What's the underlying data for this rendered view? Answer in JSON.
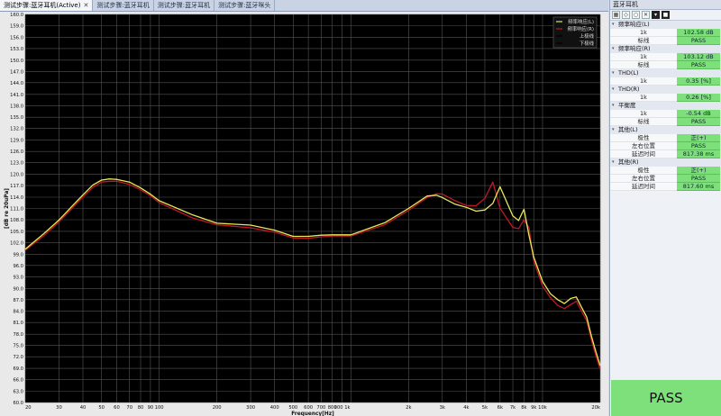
{
  "tabs": [
    {
      "label": "测试步骤:蓝牙耳机(Active)",
      "active": true
    },
    {
      "label": "测试步骤:蓝牙耳机",
      "active": false
    },
    {
      "label": "测试步骤:蓝牙耳机",
      "active": false
    },
    {
      "label": "测试步骤:蓝牙咪头",
      "active": false
    }
  ],
  "panel": {
    "title": "蓝牙耳机",
    "groups": [
      {
        "title": "频率响应(L)",
        "rows": [
          [
            "1k",
            "102.58 dB"
          ],
          [
            "标线",
            "PASS"
          ]
        ]
      },
      {
        "title": "频率响应(R)",
        "rows": [
          [
            "1k",
            "103.12 dB"
          ],
          [
            "标线",
            "PASS"
          ]
        ]
      },
      {
        "title": "THD(L)",
        "rows": [
          [
            "1k",
            "0.35 [%]"
          ]
        ]
      },
      {
        "title": "THD(R)",
        "rows": [
          [
            "1k",
            "0.26 [%]"
          ]
        ]
      },
      {
        "title": "平衡度",
        "rows": [
          [
            "1k",
            "-0.54 dB"
          ],
          [
            "标线",
            "PASS"
          ]
        ]
      },
      {
        "title": "其他(L)",
        "rows": [
          [
            "极性",
            "正(+)"
          ],
          [
            "左右位置",
            "PASS"
          ],
          [
            "延迟时间",
            "817.38 ms"
          ]
        ]
      },
      {
        "title": "其他(R)",
        "rows": [
          [
            "极性",
            "正(+)"
          ],
          [
            "左右位置",
            "PASS"
          ],
          [
            "延迟时间",
            "817.60 ms"
          ]
        ]
      }
    ],
    "result": "PASS",
    "colors": {
      "pass": "#7ee07b"
    }
  },
  "chart_data": {
    "type": "line",
    "xlabel": "Frequency[Hz]",
    "ylabel": "[dB re 20uPa]",
    "x_scale": "log",
    "xlim": [
      20,
      20000
    ],
    "ylim": [
      60,
      160
    ],
    "yticks": [
      60.0,
      62.9,
      65.9,
      68.8,
      71.8,
      74.7,
      77.6,
      80.6,
      83.5,
      86.5,
      89.4,
      92.4,
      95.3,
      98.2,
      101.2,
      104.1,
      107.1,
      110.0,
      112.9,
      115.9,
      118.8,
      121.8,
      124.7,
      127.6,
      130.6,
      133.5,
      136.5,
      139.4,
      142.4,
      145.3,
      148.2,
      151.2,
      154.1,
      157.1,
      160.0
    ],
    "ytick_labels": [
      "60.0",
      "63.0",
      "66.0",
      "69.0",
      "72.0",
      "75.0",
      "78.0",
      "81.0",
      "84.0",
      "87.0",
      "90.0",
      "93.0",
      "96.0",
      "99.0",
      "102.0",
      "105.0",
      "108.0",
      "111.0",
      "114.0",
      "117.0",
      "120.0",
      "123.0",
      "126.0",
      "129.0",
      "132.0",
      "135.0",
      "138.0",
      "141.0",
      "144.0",
      "147.0",
      "150.0",
      "153.0",
      "156.0",
      "159.0",
      "160.0"
    ],
    "xticks": [
      20,
      30,
      40,
      50,
      60,
      70,
      80,
      90,
      100,
      200,
      300,
      400,
      500,
      600,
      700,
      800,
      900,
      1000,
      2000,
      3000,
      4000,
      5000,
      6000,
      7000,
      8000,
      9000,
      10000,
      20000
    ],
    "xtick_labels": [
      "20",
      "30",
      "40",
      "50",
      "60",
      "70",
      "80",
      "90",
      "100",
      "200",
      "300",
      "400",
      "500",
      "600",
      "700",
      "800",
      "900 1k",
      "",
      "2k",
      "3k",
      "4k",
      "5k",
      "6k",
      "7k",
      "8k",
      "9k",
      "10k",
      "20k"
    ],
    "grid": true,
    "legend_position": "top-right",
    "legend": [
      "频率响应(L)",
      "频率响应(R)",
      "上极线",
      "下极线"
    ],
    "series": [
      {
        "name": "频率响应(L)",
        "color": "#e8e85a",
        "x": [
          20,
          25,
          30,
          35,
          40,
          45,
          50,
          55,
          60,
          70,
          80,
          90,
          100,
          150,
          200,
          300,
          400,
          500,
          600,
          700,
          800,
          1000,
          1500,
          2000,
          2500,
          2800,
          3000,
          3500,
          4000,
          4500,
          5000,
          5500,
          6000,
          7000,
          7500,
          8000,
          8500,
          9000,
          10000,
          11000,
          12000,
          13000,
          14000,
          15000,
          16000,
          17000,
          18000,
          19000,
          20000
        ],
        "y": [
          99.5,
          103.5,
          107.0,
          110.5,
          113.5,
          116.0,
          117.3,
          117.6,
          117.5,
          116.8,
          115.3,
          113.7,
          112.0,
          108.3,
          106.2,
          105.7,
          104.4,
          102.8,
          102.8,
          103.1,
          103.2,
          103.2,
          106.3,
          110.0,
          113.2,
          113.4,
          112.8,
          111.1,
          110.3,
          109.3,
          109.6,
          111.3,
          115.6,
          108.1,
          106.9,
          109.8,
          103.0,
          97.5,
          91.2,
          88.0,
          86.5,
          85.5,
          86.8,
          87.2,
          84.5,
          82.0,
          77.0,
          73.0,
          69.5
        ]
      },
      {
        "name": "频率响应(R)",
        "color": "#c0182a",
        "x": [
          20,
          25,
          30,
          35,
          40,
          45,
          50,
          55,
          60,
          70,
          80,
          90,
          100,
          150,
          200,
          300,
          400,
          500,
          600,
          700,
          800,
          1000,
          1500,
          2000,
          2500,
          2800,
          3000,
          3500,
          4000,
          4500,
          5000,
          5500,
          6000,
          7000,
          7500,
          8000,
          8500,
          9000,
          10000,
          11000,
          12000,
          13000,
          14000,
          15000,
          16000,
          17000,
          18000,
          19000,
          20000
        ],
        "y": [
          99.2,
          103.0,
          106.5,
          110.0,
          113.0,
          115.4,
          116.8,
          117.0,
          117.0,
          116.2,
          114.8,
          113.3,
          111.5,
          107.5,
          105.8,
          105.0,
          103.9,
          102.4,
          102.3,
          102.7,
          102.9,
          102.9,
          105.8,
          109.5,
          112.8,
          113.8,
          113.7,
          112.0,
          110.8,
          110.7,
          112.6,
          116.8,
          110.1,
          105.1,
          104.8,
          107.1,
          105.0,
          96.5,
          90.0,
          87.0,
          85.0,
          84.2,
          85.2,
          86.1,
          83.5,
          81.0,
          76.0,
          72.0,
          68.5
        ]
      }
    ]
  }
}
